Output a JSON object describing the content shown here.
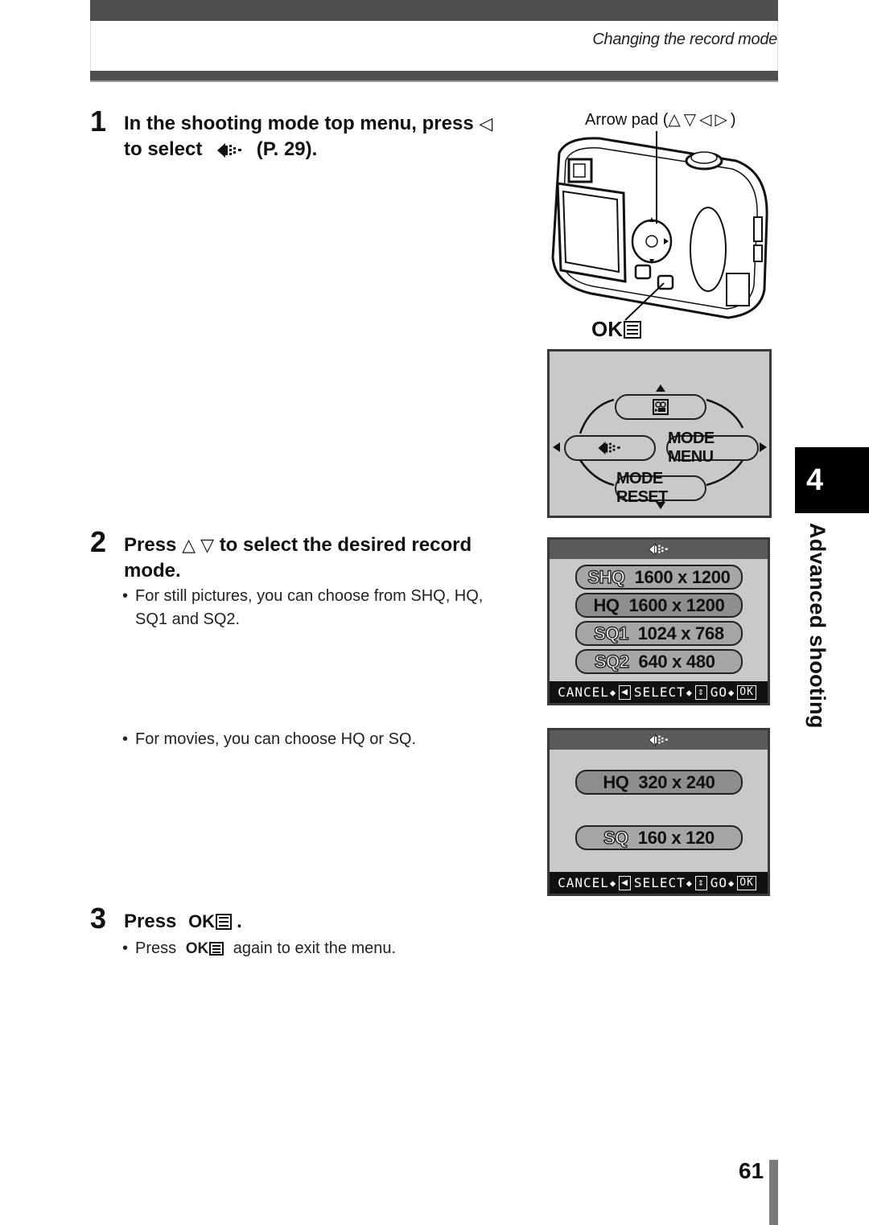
{
  "header": {
    "section_title": "Changing the record mode"
  },
  "steps": [
    {
      "number": "1",
      "text_a": "In the shooting mode top menu, press",
      "text_b": "to select",
      "text_c": "(P. 29).",
      "arrow_symbol": "◁"
    },
    {
      "number": "2",
      "text_a": "Press",
      "arrows": "△ ▽",
      "text_b": "to select the desired record",
      "text_c": "mode.",
      "bullets": [
        "For still pictures, you can choose from SHQ, HQ,",
        "SQ1 and SQ2.",
        "For movies, you can choose HQ or SQ."
      ]
    },
    {
      "number": "3",
      "text_a": "Press",
      "ok_label": "OK",
      "text_end": ".",
      "bullet_pre": "Press",
      "bullet_post": "again to exit the menu."
    }
  ],
  "camera_figure": {
    "arrow_pad_label": "Arrow pad (",
    "arrow_pad_symbols": "△▽◁▷",
    "arrow_pad_close": ")",
    "ok_label": "OK"
  },
  "top_menu_screen": {
    "top_item_icon": "movie-icon",
    "left_item_icon": "record-mode-icon",
    "right_item": "MODE MENU",
    "bottom_item": "MODE RESET"
  },
  "still_menu_screen": {
    "header_icon": "record-mode-icon",
    "options": [
      {
        "quality": "SHQ",
        "resolution": "1600 x 1200",
        "selected": false
      },
      {
        "quality": "HQ",
        "resolution": "1600 x 1200",
        "selected": true
      },
      {
        "quality": "SQ1",
        "resolution": "1024 x 768",
        "selected": false
      },
      {
        "quality": "SQ2",
        "resolution": "640 x 480",
        "selected": false
      }
    ],
    "footer": {
      "cancel": "CANCEL",
      "select": "SELECT",
      "go": "GO",
      "ok": "OK"
    }
  },
  "movie_menu_screen": {
    "header_icon": "record-mode-icon",
    "options": [
      {
        "quality": "HQ",
        "resolution": "320 x 240",
        "selected": true
      },
      {
        "quality": "SQ",
        "resolution": "160 x 120",
        "selected": false
      }
    ],
    "footer": {
      "cancel": "CANCEL",
      "select": "SELECT",
      "go": "GO",
      "ok": "OK"
    }
  },
  "chapter": {
    "number": "4",
    "title": "Advanced shooting"
  },
  "page_number": "61"
}
